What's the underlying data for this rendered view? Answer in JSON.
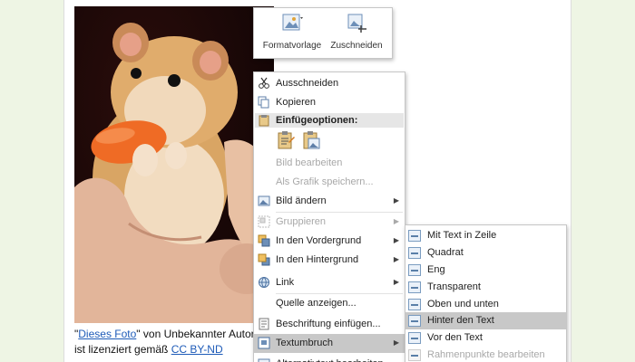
{
  "caption": {
    "quote_open": "\"",
    "link1": "Dieses Foto",
    "middle": "\" von Unbekannter Autor",
    "line2": "ist lizenziert gemäß ",
    "link2": "CC BY-ND"
  },
  "minibar": {
    "style_label": "Formatvorlage",
    "crop_label": "Zuschneiden"
  },
  "menu": {
    "cut": "Ausschneiden",
    "copy": "Kopieren",
    "paste_options": "Einfügeoptionen:",
    "edit_image": "Bild bearbeiten",
    "save_as_image": "Als Grafik speichern...",
    "change_image": "Bild ändern",
    "group": "Gruppieren",
    "bring_front": "In den Vordergrund",
    "send_back": "In den Hintergrund",
    "link": "Link",
    "show_source": "Quelle anzeigen...",
    "insert_caption": "Beschriftung einfügen...",
    "text_wrap": "Textumbruch",
    "alt_text": "Alternativtext bearbeiten..."
  },
  "submenu": {
    "items": [
      "Mit Text in Zeile",
      "Quadrat",
      "Eng",
      "Transparent",
      "Oben und unten",
      "Hinter den Text",
      "Vor den Text",
      "Rahmenpunkte bearbeiten"
    ]
  },
  "colors": {
    "link": "#1e5bb8",
    "menu_highlight": "#c8c8c8",
    "background": "#eef5e4"
  }
}
